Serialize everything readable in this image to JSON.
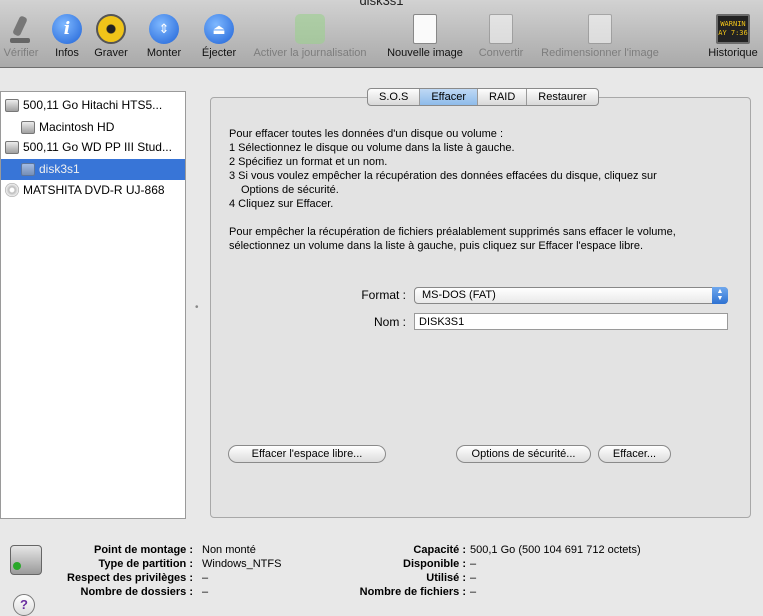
{
  "window": {
    "title": "disk3s1"
  },
  "toolbar": {
    "verify": "Vérifier",
    "info": "Infos",
    "burn": "Graver",
    "mount": "Monter",
    "eject": "Éjecter",
    "enable_journaling": "Activer la journalisation",
    "new_image": "Nouvelle image",
    "convert": "Convertir",
    "resize_image": "Redimensionner l'image",
    "log": "Historique",
    "log_icon_text": "WARNIN\nAY 7:36"
  },
  "sidebar": {
    "items": [
      {
        "label": "500,11 Go Hitachi HTS5..."
      },
      {
        "label": "Macintosh HD"
      },
      {
        "label": "500,11 Go WD PP III Stud..."
      },
      {
        "label": "disk3s1"
      },
      {
        "label": "MATSHITA DVD-R UJ-868"
      }
    ]
  },
  "tabs": [
    {
      "label": "S.O.S"
    },
    {
      "label": "Effacer"
    },
    {
      "label": "RAID"
    },
    {
      "label": "Restaurer"
    }
  ],
  "erase": {
    "instructions": {
      "line1": "Pour effacer toutes les données d'un disque ou volume :",
      "line2": "1 Sélectionnez le disque ou volume dans la liste à gauche.",
      "line3": "2 Spécifiez un format et un nom.",
      "line4": "3 Si vous voulez empêcher la récupération des données effacées du disque, cliquez sur",
      "line5": "Options de sécurité.",
      "line6": "4 Cliquez sur Effacer.",
      "line7": "Pour empêcher la récupération de fichiers préalablement supprimés sans effacer le volume,",
      "line8": "sélectionnez un volume dans la liste à gauche, puis cliquez sur Effacer l'espace libre."
    },
    "format_label": "Format :",
    "format_value": "MS-DOS (FAT)",
    "name_label": "Nom :",
    "name_value": "DISK3S1",
    "erase_free_space": "Effacer l'espace libre...",
    "security_options": "Options de sécurité...",
    "erase_button": "Effacer..."
  },
  "info": {
    "mount_point": {
      "key": "Point de montage :",
      "value": "Non monté"
    },
    "partition_type": {
      "key": "Type de partition :",
      "value": "Windows_NTFS"
    },
    "permissions": {
      "key": "Respect des privilèges :",
      "value": "–"
    },
    "folder_count": {
      "key": "Nombre de dossiers :",
      "value": "–"
    },
    "capacity": {
      "key": "Capacité :",
      "value": "500,1 Go (500 104 691 712 octets)"
    },
    "available": {
      "key": "Disponible :",
      "value": "–"
    },
    "used": {
      "key": "Utilisé :",
      "value": "–"
    },
    "file_count": {
      "key": "Nombre de fichiers :",
      "value": "–"
    },
    "help_label": "?"
  }
}
